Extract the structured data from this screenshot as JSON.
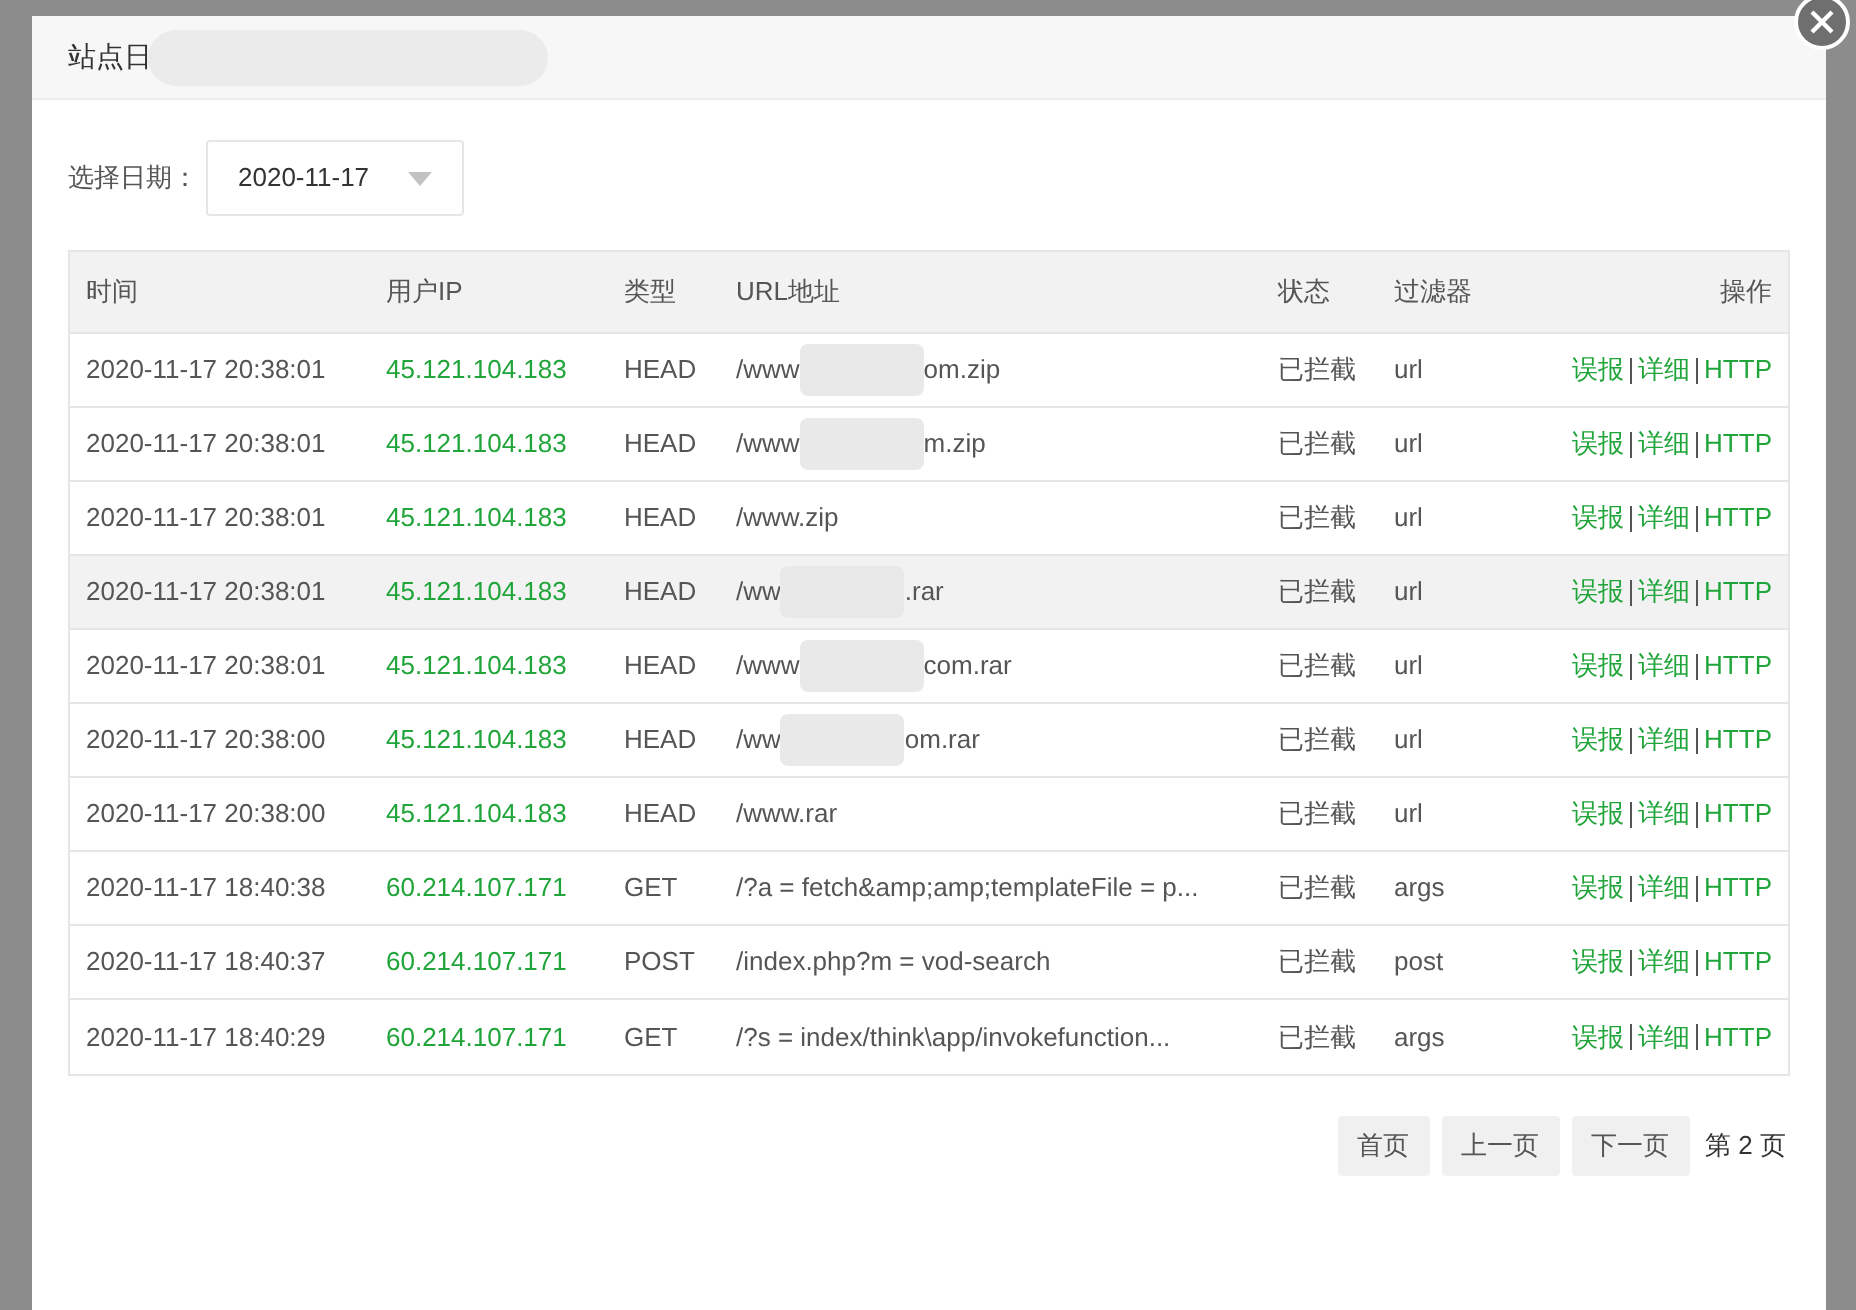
{
  "dialog": {
    "title": "站点日"
  },
  "date_filter": {
    "label": "选择日期：",
    "value": "2020-11-17"
  },
  "table": {
    "columns": [
      "时间",
      "用户IP",
      "类型",
      "URL地址",
      "状态",
      "过滤器",
      "操作"
    ],
    "rows": [
      {
        "time": "2020-11-17 20:38:01",
        "ip": "45.121.104.183",
        "type": "HEAD",
        "url": [
          "/www",
          "om.zip"
        ],
        "status": "已拦截",
        "filter": "url",
        "actions": [
          "误报",
          "详细",
          "HTTP"
        ],
        "highlighted": false
      },
      {
        "time": "2020-11-17 20:38:01",
        "ip": "45.121.104.183",
        "type": "HEAD",
        "url": [
          "/www",
          "m.zip"
        ],
        "status": "已拦截",
        "filter": "url",
        "actions": [
          "误报",
          "详细",
          "HTTP"
        ],
        "highlighted": false
      },
      {
        "time": "2020-11-17 20:38:01",
        "ip": "45.121.104.183",
        "type": "HEAD",
        "url": [
          "/www.zip"
        ],
        "status": "已拦截",
        "filter": "url",
        "actions": [
          "误报",
          "详细",
          "HTTP"
        ],
        "highlighted": false
      },
      {
        "time": "2020-11-17 20:38:01",
        "ip": "45.121.104.183",
        "type": "HEAD",
        "url": [
          "/ww",
          ".rar"
        ],
        "status": "已拦截",
        "filter": "url",
        "actions": [
          "误报",
          "详细",
          "HTTP"
        ],
        "highlighted": true
      },
      {
        "time": "2020-11-17 20:38:01",
        "ip": "45.121.104.183",
        "type": "HEAD",
        "url": [
          "/www",
          "com.rar"
        ],
        "status": "已拦截",
        "filter": "url",
        "actions": [
          "误报",
          "详细",
          "HTTP"
        ],
        "highlighted": false
      },
      {
        "time": "2020-11-17 20:38:00",
        "ip": "45.121.104.183",
        "type": "HEAD",
        "url": [
          "/ww",
          "om.rar"
        ],
        "status": "已拦截",
        "filter": "url",
        "actions": [
          "误报",
          "详细",
          "HTTP"
        ],
        "highlighted": false
      },
      {
        "time": "2020-11-17 20:38:00",
        "ip": "45.121.104.183",
        "type": "HEAD",
        "url": [
          "/www.rar"
        ],
        "status": "已拦截",
        "filter": "url",
        "actions": [
          "误报",
          "详细",
          "HTTP"
        ],
        "highlighted": false
      },
      {
        "time": "2020-11-17 18:40:38",
        "ip": "60.214.107.171",
        "type": "GET",
        "url": [
          "/?a = fetch&amp;amp;templateFile = p..."
        ],
        "status": "已拦截",
        "filter": "args",
        "actions": [
          "误报",
          "详细",
          "HTTP"
        ],
        "highlighted": false
      },
      {
        "time": "2020-11-17 18:40:37",
        "ip": "60.214.107.171",
        "type": "POST",
        "url": [
          "/index.php?m = vod-search"
        ],
        "status": "已拦截",
        "filter": "post",
        "actions": [
          "误报",
          "详细",
          "HTTP"
        ],
        "highlighted": false
      },
      {
        "time": "2020-11-17 18:40:29",
        "ip": "60.214.107.171",
        "type": "GET",
        "url": [
          "/?s = index/think\\app/invokefunction..."
        ],
        "status": "已拦截",
        "filter": "args",
        "actions": [
          "误报",
          "详细",
          "HTTP"
        ],
        "highlighted": false
      }
    ]
  },
  "pagination": {
    "buttons": [
      "首页",
      "上一页",
      "下一页"
    ],
    "page": "第 2 页"
  }
}
